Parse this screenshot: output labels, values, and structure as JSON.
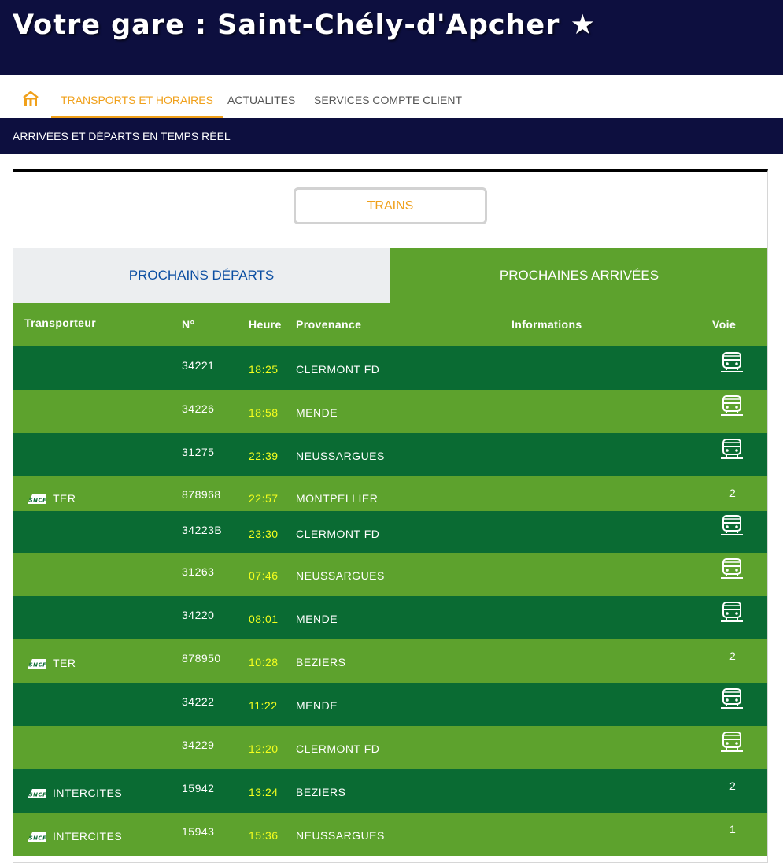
{
  "header": {
    "title": "Votre gare : Saint-Chély-d'Apcher ★"
  },
  "nav": {
    "home_icon": "home-icon",
    "tabs": [
      {
        "label": "TRANSPORTS ET HORAIRES",
        "active": true
      },
      {
        "label": "ACTUALITES",
        "active": false
      },
      {
        "label": "SERVICES COMPTE CLIENT",
        "active": false
      }
    ]
  },
  "subnav": {
    "label": "ARRIVÉES ET DÉPARTS EN TEMPS RÉEL"
  },
  "panel": {
    "trains_button": "TRAINS",
    "tabs": [
      {
        "label": "PROCHAINS DÉPARTS",
        "active": false
      },
      {
        "label": "PROCHAINES ARRIVÉES",
        "active": true
      }
    ],
    "columns": {
      "transporteur": "Transporteur",
      "numero": "N°",
      "heure": "Heure",
      "provenance": "Provenance",
      "informations": "Informations",
      "voie": "Voie"
    },
    "rows": [
      {
        "transporteur": "",
        "logo": false,
        "numero": "34221",
        "heure": "18:25",
        "provenance": "CLERMONT FD",
        "informations": "",
        "voie": "",
        "voie_icon": "bus-icon"
      },
      {
        "transporteur": "",
        "logo": false,
        "numero": "34226",
        "heure": "18:58",
        "provenance": "MENDE",
        "informations": "",
        "voie": "",
        "voie_icon": "bus-icon"
      },
      {
        "transporteur": "",
        "logo": false,
        "numero": "31275",
        "heure": "22:39",
        "provenance": "NEUSSARGUES",
        "informations": "",
        "voie": "",
        "voie_icon": "bus-icon"
      },
      {
        "transporteur": "TER",
        "logo": true,
        "numero": "878968",
        "heure": "22:57",
        "provenance": "MONTPELLIER",
        "informations": "",
        "voie": "2",
        "voie_icon": ""
      },
      {
        "transporteur": "",
        "logo": false,
        "numero": "34223B",
        "heure": "23:30",
        "provenance": "CLERMONT FD",
        "informations": "",
        "voie": "",
        "voie_icon": "bus-icon"
      },
      {
        "transporteur": "",
        "logo": false,
        "numero": "31263",
        "heure": "07:46",
        "provenance": "NEUSSARGUES",
        "informations": "",
        "voie": "",
        "voie_icon": "bus-icon"
      },
      {
        "transporteur": "",
        "logo": false,
        "numero": "34220",
        "heure": "08:01",
        "provenance": "MENDE",
        "informations": "",
        "voie": "",
        "voie_icon": "bus-icon"
      },
      {
        "transporteur": "TER",
        "logo": true,
        "numero": "878950",
        "heure": "10:28",
        "provenance": "BEZIERS",
        "informations": "",
        "voie": "2",
        "voie_icon": ""
      },
      {
        "transporteur": "",
        "logo": false,
        "numero": "34222",
        "heure": "11:22",
        "provenance": "MENDE",
        "informations": "",
        "voie": "",
        "voie_icon": "bus-icon"
      },
      {
        "transporteur": "",
        "logo": false,
        "numero": "34229",
        "heure": "12:20",
        "provenance": "CLERMONT FD",
        "informations": "",
        "voie": "",
        "voie_icon": "bus-icon"
      },
      {
        "transporteur": "INTERCITES",
        "logo": true,
        "numero": "15942",
        "heure": "13:24",
        "provenance": "BEZIERS",
        "informations": "",
        "voie": "2",
        "voie_icon": ""
      },
      {
        "transporteur": "INTERCITES",
        "logo": true,
        "numero": "15943",
        "heure": "15:36",
        "provenance": "NEUSSARGUES",
        "informations": "",
        "voie": "1",
        "voie_icon": ""
      }
    ]
  },
  "colors": {
    "navy": "#0d0f3f",
    "accent_orange": "#f0a01a",
    "green_light": "#5da22d",
    "green_dark": "#0a6b33",
    "time_yellow": "#f5ff1e",
    "tab_blue": "#0b4ea2"
  }
}
